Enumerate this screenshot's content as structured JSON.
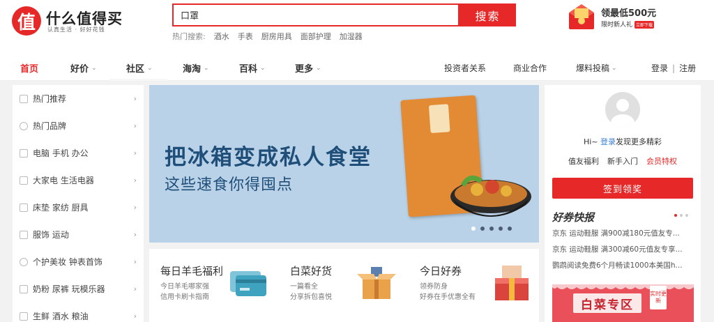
{
  "header": {
    "logo_char": "值",
    "logo_title": "什么值得买",
    "logo_slogan": "认真生活 · 好好花钱",
    "search_value": "口罩",
    "search_button": "搜索",
    "hot_label": "热门搜索:",
    "hot_keywords": [
      "酒水",
      "手表",
      "厨房用具",
      "面部护理",
      "加湿器"
    ],
    "promo_title": "领最低500元",
    "promo_sub": "限时新人礼",
    "promo_tag": "立即下载"
  },
  "nav": {
    "items": [
      {
        "label": "首页",
        "active": true
      },
      {
        "label": "好价",
        "dropdown": true
      },
      {
        "label": "社区",
        "dropdown": true
      },
      {
        "label": "海淘",
        "dropdown": true
      },
      {
        "label": "百科",
        "dropdown": true
      },
      {
        "label": "更多",
        "dropdown": true
      }
    ],
    "right": [
      "投资者关系",
      "商业合作",
      "爆料投稿"
    ],
    "login": "登录",
    "separator": "|",
    "register": "注册"
  },
  "sidebar": {
    "items": [
      "热门推荐",
      "热门品牌",
      "电脑  手机  办公",
      "大家电  生活电器",
      "床垫  家纺  厨具",
      "服饰  运动",
      "个护美妆  钟表首饰",
      "奶粉  尿裤  玩模乐器",
      "生鲜  酒水  粮油"
    ]
  },
  "banner": {
    "title": "把冰箱变成私人食堂",
    "subtitle": "这些速食你得囤点",
    "slide_count": 5,
    "active_slide": 0
  },
  "cards": [
    {
      "title": "每日羊毛福利",
      "desc": [
        "今日羊毛哪家强",
        "信用卡刷卡指南"
      ],
      "icon": "credit-card-icon"
    },
    {
      "title": "白菜好货",
      "desc": [
        "一篇看全",
        "分享拆包喜悦"
      ],
      "icon": "gift-box-icon"
    },
    {
      "title": "今日好券",
      "desc": [
        "领券防身",
        "好券在手优惠全有"
      ],
      "icon": "coupon-box-icon"
    }
  ],
  "user_panel": {
    "greeting_prefix": "Hi~ ",
    "login_link": "登录",
    "greeting_suffix": "发现更多精彩",
    "links": [
      "值友福利",
      "新手入门",
      "会员特权"
    ],
    "checkin_button": "签到领奖"
  },
  "coupons": {
    "title": "好券快报",
    "items": [
      "京东  运动鞋服 满900减180元值友专...",
      "京东  运动鞋服 满300减60元值友专享...",
      "鹦鹉阅读免费6个月畅读1000本美国h..."
    ],
    "baicai_label": "白菜专区",
    "baicai_tag": "实时更新"
  },
  "colors": {
    "brand_red": "#e62828",
    "link_blue": "#3a7fd5",
    "banner_bg": "#b9d2e8",
    "banner_text": "#1f4e79"
  }
}
